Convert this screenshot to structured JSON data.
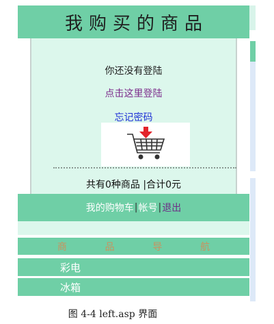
{
  "header": {
    "title": "我购买的商品"
  },
  "login": {
    "status": "你还没有登陆",
    "login_link": "点击这里登陆",
    "forgot_link": "忘记密码"
  },
  "cart": {
    "summary": "共有0种商品 |合计0元",
    "my_cart": "我的购物车",
    "separator": "|",
    "account": "帐号",
    "logout": "退出"
  },
  "nav": {
    "header_chars": [
      "商",
      "品",
      "导",
      "航"
    ],
    "items": [
      "彩电",
      "冰箱"
    ]
  },
  "caption": "图 4-4 left.asp 界面",
  "colors": {
    "accent": "#6fcfa6",
    "panel": "#dcf7ec",
    "login_link": "#7d2d8c",
    "forgot_link": "#1f32d6",
    "cart_icon": "#e3242b"
  },
  "icons": {
    "cart": "shopping-cart-icon",
    "arrow": "arrow-down-icon"
  }
}
